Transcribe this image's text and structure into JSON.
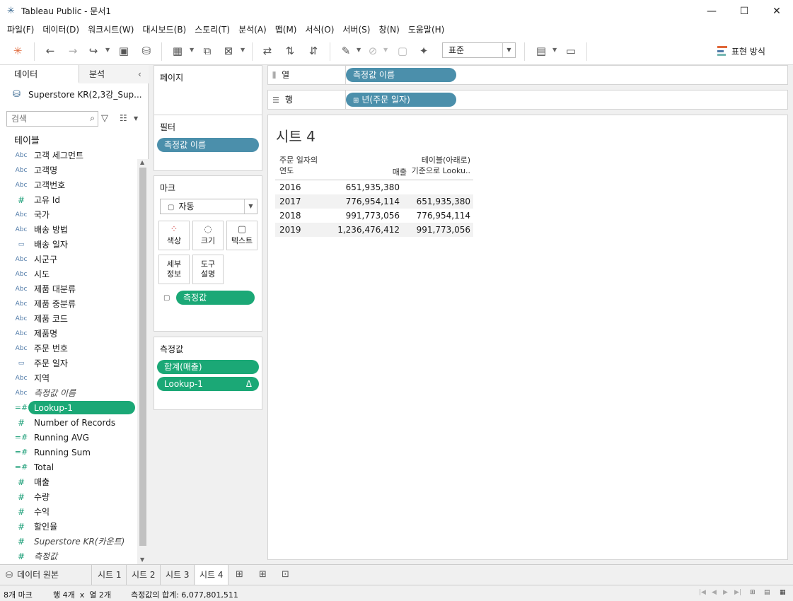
{
  "window": {
    "title": "Tableau Public - 문서1",
    "controls": [
      "—",
      "☐",
      "✕"
    ]
  },
  "menu": [
    "파일(F)",
    "데이터(D)",
    "워크시트(W)",
    "대시보드(B)",
    "스토리(T)",
    "분석(A)",
    "맵(M)",
    "서식(O)",
    "서버(S)",
    "창(N)",
    "도움말(H)"
  ],
  "toolbar": {
    "fit_value": "표준",
    "show_me_label": "표현 방식"
  },
  "data_pane": {
    "tab_data": "데이터",
    "tab_analysis": "분석",
    "datasource": "Superstore KR(2,3강_Sup...",
    "search_placeholder": "검색",
    "tables_heading": "테이블",
    "fields": [
      {
        "icon": "Abc",
        "name": "고객 세그먼트"
      },
      {
        "icon": "Abc",
        "name": "고객명"
      },
      {
        "icon": "Abc",
        "name": "고객번호"
      },
      {
        "icon": "#",
        "name": "고유 Id"
      },
      {
        "icon": "Abc",
        "name": "국가"
      },
      {
        "icon": "Abc",
        "name": "배송 방법"
      },
      {
        "icon": "▭",
        "name": "배송 일자"
      },
      {
        "icon": "Abc",
        "name": "시군구"
      },
      {
        "icon": "Abc",
        "name": "시도"
      },
      {
        "icon": "Abc",
        "name": "제품 대분류"
      },
      {
        "icon": "Abc",
        "name": "제품 중분류"
      },
      {
        "icon": "Abc",
        "name": "제품 코드"
      },
      {
        "icon": "Abc",
        "name": "제품명"
      },
      {
        "icon": "Abc",
        "name": "주문 번호"
      },
      {
        "icon": "▭",
        "name": "주문 일자"
      },
      {
        "icon": "Abc",
        "name": "지역"
      },
      {
        "icon": "Abc",
        "name": "측정값 이름"
      },
      {
        "icon": "=#",
        "name": "Lookup-1"
      },
      {
        "icon": "#",
        "name": "Number of Records"
      },
      {
        "icon": "=#",
        "name": "Running AVG"
      },
      {
        "icon": "=#",
        "name": "Running Sum"
      },
      {
        "icon": "=#",
        "name": "Total"
      },
      {
        "icon": "#",
        "name": "매출"
      },
      {
        "icon": "#",
        "name": "수량"
      },
      {
        "icon": "#",
        "name": "수익"
      },
      {
        "icon": "#",
        "name": "할인율"
      },
      {
        "icon": "#",
        "name": "Superstore KR(카운트)"
      },
      {
        "icon": "#",
        "name": "측정값"
      }
    ]
  },
  "cards": {
    "pages_title": "페이지",
    "filters_title": "필터",
    "filter_pill": "측정값 이름",
    "marks_title": "마크",
    "marks_type": "자동",
    "mark_buttons": [
      "색상",
      "크기",
      "텍스트",
      "세부\n정보",
      "도구\n설명"
    ],
    "marks_pill": "측정값",
    "measures_title": "측정값",
    "measure_pills": [
      "합계(매출)",
      "Lookup-1"
    ],
    "delta_symbol": "Δ"
  },
  "shelves": {
    "columns_label": "열",
    "columns_pill": "측정값 이름",
    "rows_label": "행",
    "rows_pill": "년(주문 일자)"
  },
  "view": {
    "sheet_title": "시트 4",
    "header_row_field": "주문 일자의\n연도",
    "header_col1": "매출",
    "header_col2": "테이블(아래로)\n기준으로 Looku..",
    "rows": [
      {
        "year": "2016",
        "sales": "651,935,380",
        "lookup": ""
      },
      {
        "year": "2017",
        "sales": "776,954,114",
        "lookup": "651,935,380"
      },
      {
        "year": "2018",
        "sales": "991,773,056",
        "lookup": "776,954,114"
      },
      {
        "year": "2019",
        "sales": "1,236,476,412",
        "lookup": "991,773,056"
      }
    ]
  },
  "sheet_tabs": {
    "datasource_tab": "데이터 원본",
    "sheets": [
      "시트 1",
      "시트 2",
      "시트 3",
      "시트 4"
    ],
    "active": "시트 4"
  },
  "status": {
    "marks": "8개 마크",
    "dims": "행 4개  x  열 2개",
    "sum": "측정값의 합계: 6,077,801,511"
  },
  "colors": {
    "pill_blue": "#4b8fab",
    "pill_green": "#1ba876"
  }
}
